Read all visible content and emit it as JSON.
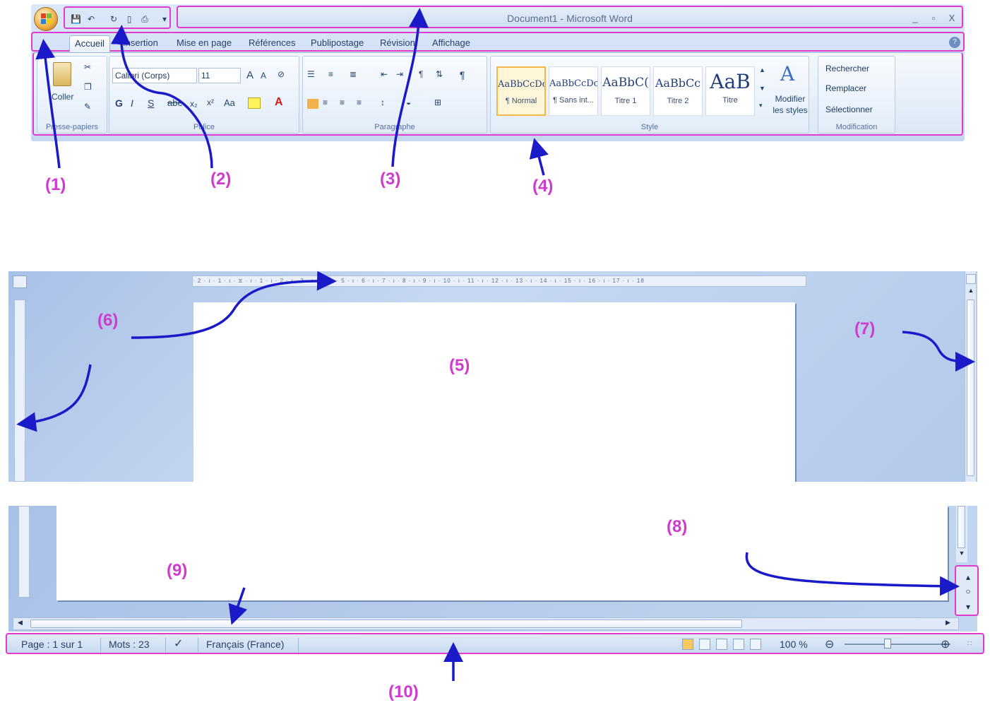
{
  "window": {
    "title": "Document1 - Microsoft Word",
    "controls": [
      "_",
      "▫",
      "X"
    ]
  },
  "tabs": [
    "Accueil",
    "Insertion",
    "Mise en page",
    "Références",
    "Publipostage",
    "Révision",
    "Affichage"
  ],
  "ribbon": {
    "clipboard": {
      "paste_label": "Coller",
      "group_label": "Presse-papiers"
    },
    "font": {
      "font_name": "Calibri (Corps)",
      "font_size": "11",
      "group_label": "Police"
    },
    "paragraph": {
      "group_label": "Paragraphe"
    },
    "styles": {
      "group_label": "Style",
      "tiles": [
        {
          "sample": "AaBbCcDc",
          "name": "¶ Normal"
        },
        {
          "sample": "AaBbCcDc",
          "name": "¶ Sans int..."
        },
        {
          "sample": "AaBbC(",
          "name": "Titre 1"
        },
        {
          "sample": "AaBbCc",
          "name": "Titre 2"
        },
        {
          "sample": "AaB",
          "name": "Titre"
        }
      ],
      "change_styles": "Modifier les styles"
    },
    "editing": {
      "group_label": "Modification",
      "items": [
        "Rechercher",
        "Remplacer",
        "Sélectionner"
      ]
    }
  },
  "ruler_text": "· 2 · ı · 1 · ı · ⧖ · ı · 1 · ı · 2 · ı · 3 · ı · 4 · ı · 5 · ı · 6 · ı · 7 · ı · 8 · ı · 9 · ı · 10 · ı · 11 · ı · 12 · ı · 13 · ı · 14 · ı · 15 · ı · 16 · ı · 17 · ı · 18",
  "status_bar": {
    "page": "Page : 1 sur 1",
    "words": "Mots : 23",
    "language": "Français (France)",
    "zoom": "100 %"
  },
  "callouts": [
    "(1)",
    "(2)",
    "(3)",
    "(4)",
    "(5)",
    "(6)",
    "(7)",
    "(8)",
    "(9)",
    "(10)"
  ],
  "colors": {
    "highlight": "#e03ad0",
    "arrow": "#1a1ac8",
    "ribbon_blue": "#c5d8f0"
  }
}
